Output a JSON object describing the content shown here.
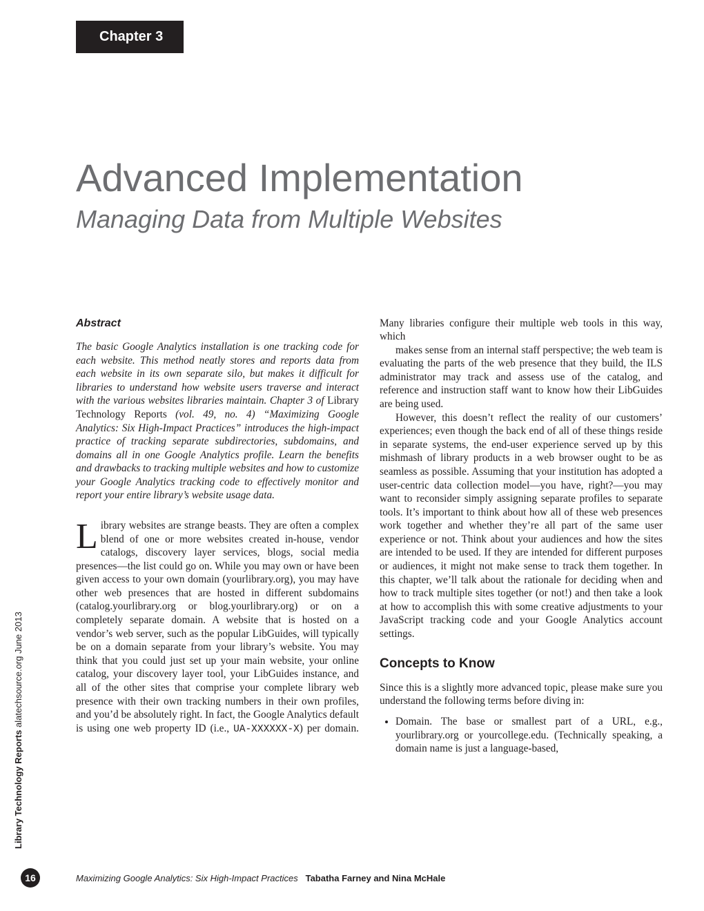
{
  "chapter_tag": "Chapter 3",
  "title": "Advanced Implementation",
  "subtitle": "Managing Data from Multiple Websites",
  "abstract_heading": "Abstract",
  "abstract_text_1": "The basic Google Analytics installation is one tracking code for each website. This method neatly stores and reports data from each website in its own separate silo, but makes it difficult for libraries to understand how website users traverse and interact with the various websites libraries maintain. Chapter 3 of ",
  "abstract_roman": "Library Technology Reports",
  "abstract_text_2": " (vol. 49, no. 4) “Maximizing Google Analytics: Six High-Impact Practices” introduces the high-impact practice of tracking separate subdirectories, subdomains, and domains all in one Google Analytics profile. Learn the benefits and drawbacks to tracking multiple websites and how to customize your Google Analytics tracking code to effectively monitor and report your entire library’s website usage data.",
  "dropcap": "L",
  "body_p1": "ibrary websites are strange beasts. They are often a complex blend of one or more websites created in-house, vendor catalogs, discovery layer services, blogs, social media presences—the list could go on. While you may own or have been given access to your own domain (yourlibrary.org), you may have other web presences that are hosted in different subdomains (catalog.yourlibrary.org or blog.yourlibrary.org) or on a completely separate domain. A website that is hosted on a vendor’s web server, such as the popular LibGuides, will typically be on a domain separate from your library’s website. You may think that you could just set up your main website, your online catalog, your discovery layer tool, your LibGuides instance, and all of the other sites that comprise your complete library web presence with their own tracking numbers in their own profiles, and you’d be absolutely right. In fact, the Google Analytics default is using one web property ID (i.e., ",
  "body_p1_code": "UA-XXXXXX-X",
  "body_p1_tail": ") per domain. Many libraries configure their multiple web tools in this way, which",
  "body_p2": "makes sense from an internal staff perspective; the web team is evaluating the parts of the web presence that they build, the ILS administrator may track and assess use of the catalog, and reference and instruction staff want to know how their LibGuides are being used.",
  "body_p3": "However, this doesn’t reflect the reality of our customers’ experiences; even though the back end of all of these things reside in separate systems, the end-user experience served up by this mishmash of library products in a web browser ought to be as seamless as possible. Assuming that your institution has adopted a user-centric data collection model—you have, right?—you may want to reconsider simply assigning separate profiles to separate tools. It’s important to think about how all of these web presences work together and whether they’re all part of the same user experience or not. Think about your audiences and how the sites are intended to be used. If they are intended for different purposes or audiences, it might not make sense to track them together. In this chapter, we’ll talk about the rationale for deciding when and how to track multiple sites together (or not!) and then take a look at how to accomplish this with some creative adjustments to your JavaScript tracking code and your Google Analytics account settings.",
  "section_heading": "Concepts to Know",
  "body_p4": "Since this is a slightly more advanced topic, please make sure you understand the following terms before diving in:",
  "bullet1": "Domain. The base or smallest part of a URL, e.g., yourlibrary.org or yourcollege.edu. (Technically speaking, a domain name is just a language-based,",
  "side_bold": "Library Technology Reports",
  "side_rest": "  alatechsource.org   June 2013",
  "page_number": "16",
  "footer_title": "Maximizing Google Analytics: Six High-Impact Practices",
  "footer_authors": "Tabatha Farney and Nina McHale"
}
